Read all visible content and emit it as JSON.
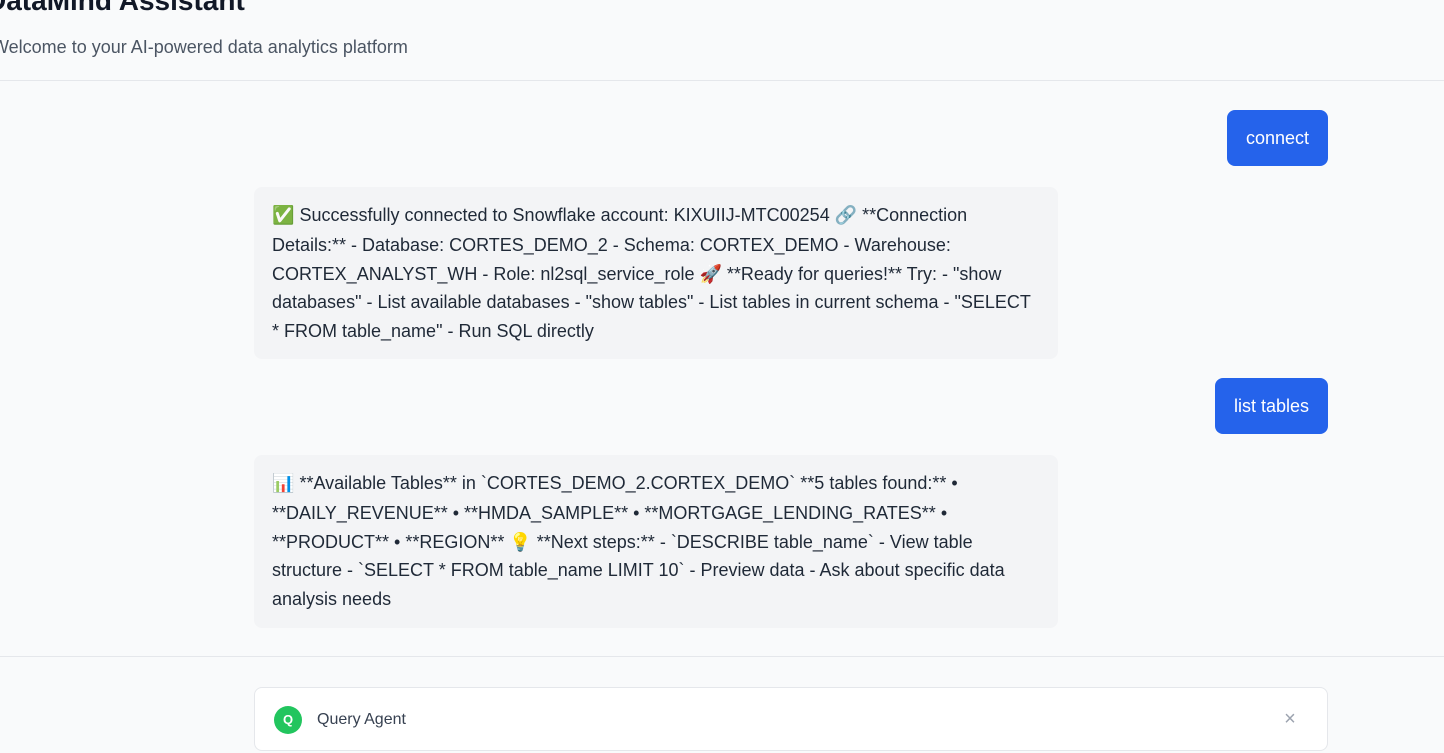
{
  "header": {
    "title": "DataMind Assistant",
    "subtitle": "Welcome to your AI-powered data analytics platform"
  },
  "messages": [
    {
      "role": "user",
      "text": "connect"
    },
    {
      "role": "assistant",
      "emoji_start": "✅",
      "text": "Successfully connected to Snowflake account: KIXUIIJ-MTC00254 🔗 **Connection Details:** - Database: CORTES_DEMO_2 - Schema: CORTEX_DEMO - Warehouse: CORTEX_ANALYST_WH - Role: nl2sql_service_role 🚀 **Ready for queries!** Try: - \"show databases\" - List available databases - \"show tables\" - List tables in current schema - \"SELECT * FROM table_name\" - Run SQL directly"
    },
    {
      "role": "user",
      "text": "list tables"
    },
    {
      "role": "assistant",
      "emoji_start": "📊",
      "text": "**Available Tables** in `CORTES_DEMO_2.CORTEX_DEMO` **5 tables found:** • **DAILY_REVENUE** • **HMDA_SAMPLE** • **MORTGAGE_LENDING_RATES** • **PRODUCT** • **REGION** 💡 **Next steps:** - `DESCRIBE table_name` - View table structure - `SELECT * FROM table_name LIMIT 10` - Preview data - Ask about specific data analysis needs"
    }
  ],
  "input_bar": {
    "agent_initial": "Q",
    "agent_label": "Query Agent",
    "close_icon": "×"
  },
  "colors": {
    "accent": "#2563eb",
    "agent_badge": "#22c55e",
    "bot_bubble": "#f3f4f6"
  }
}
